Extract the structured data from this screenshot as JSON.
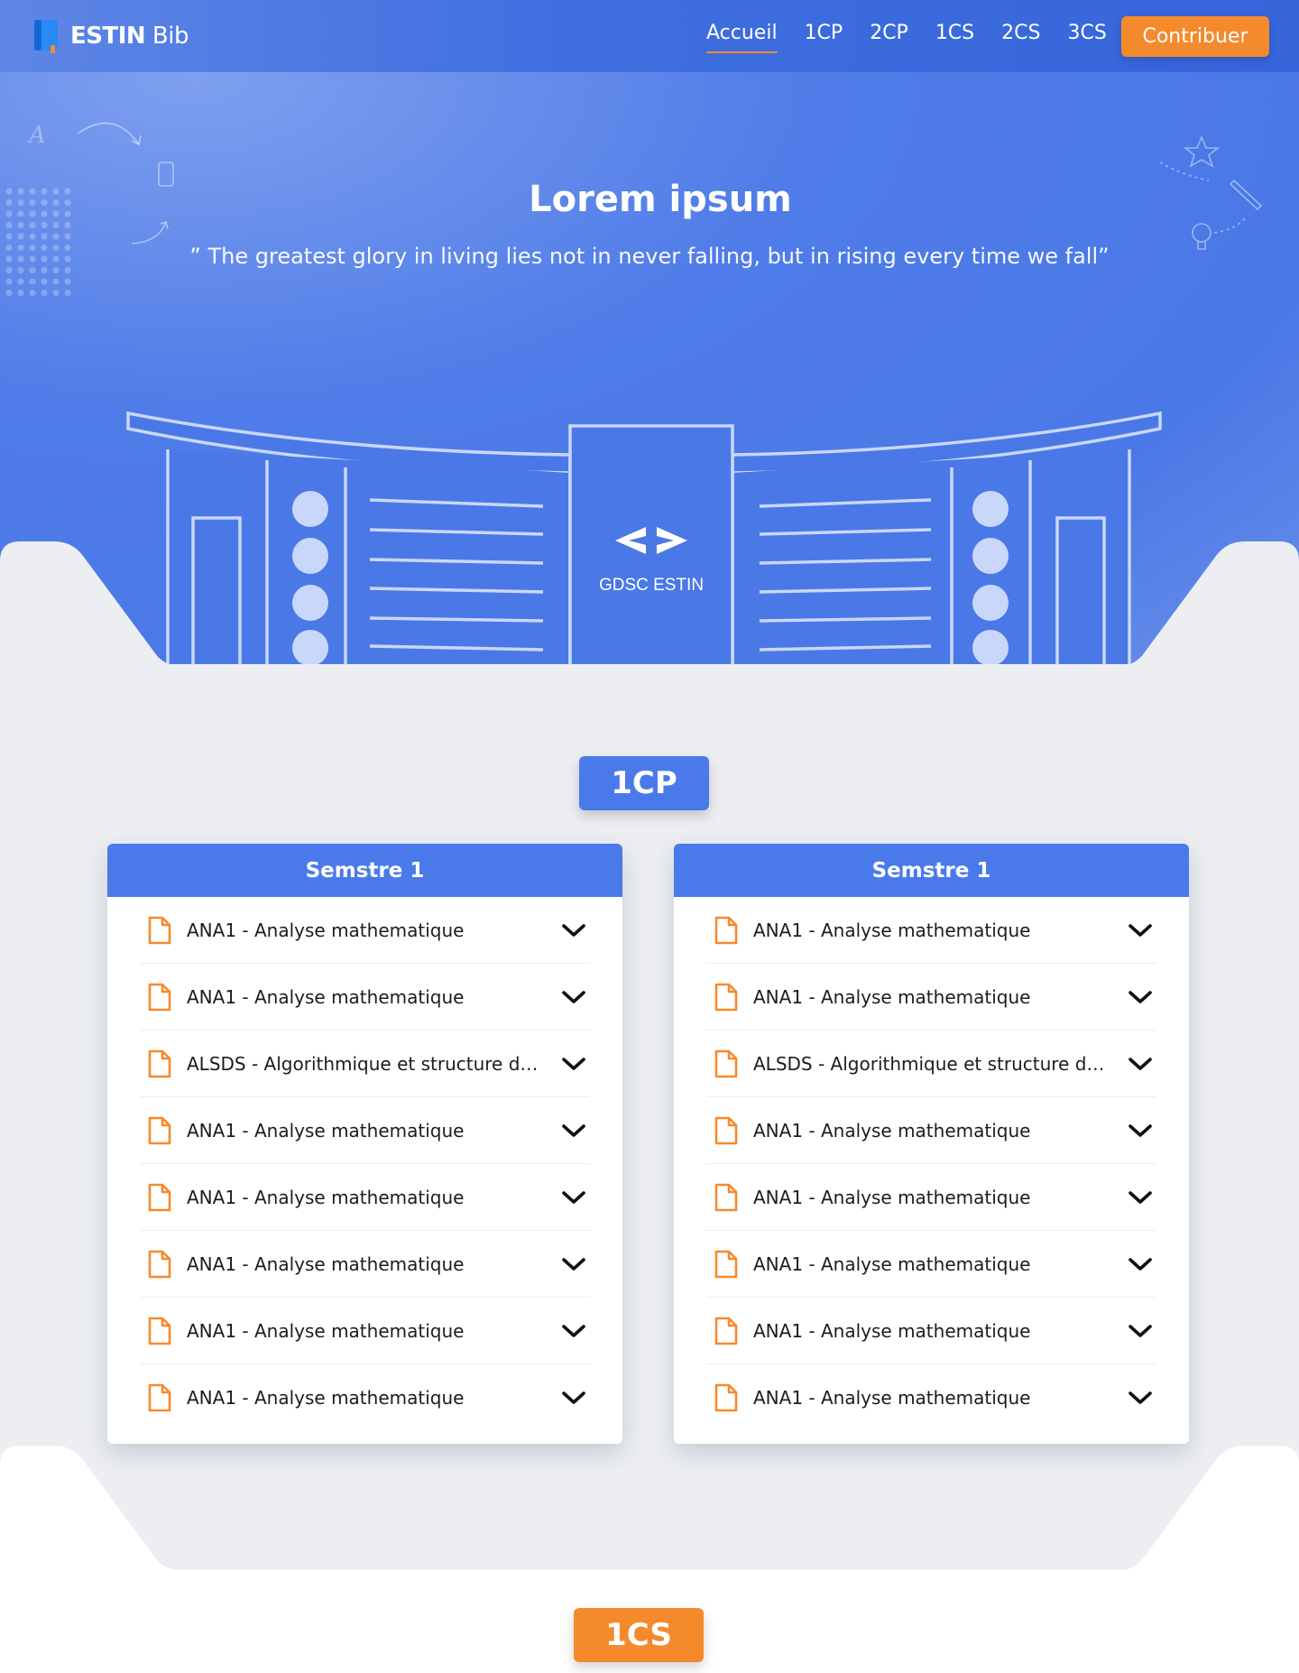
{
  "nav": {
    "brand_bold": "ESTIN",
    "brand_rest": " Bib",
    "links": [
      "Accueil",
      "1CP",
      "2CP",
      "1CS",
      "2CS",
      "3CS"
    ],
    "active": "Accueil",
    "cta_label": "Contribuer"
  },
  "hero": {
    "title": "Lorem ipsum",
    "quote": "” The greatest glory in living lies not in never falling, but in rising every time we fall”",
    "building_sign": "GDSC ESTIN"
  },
  "sections": [
    {
      "badge": "1CP",
      "badge_color": "#4a7aea",
      "cards": [
        {
          "title": "Semstre 1",
          "items": [
            "ANA1 - Analyse mathematique",
            "ANA1 - Analyse mathematique",
            "ALSDS - Algorithmique et structure de...",
            "ANA1 - Analyse mathematique",
            "ANA1 - Analyse mathematique",
            "ANA1 - Analyse mathematique",
            "ANA1 - Analyse mathematique",
            "ANA1 - Analyse mathematique"
          ]
        },
        {
          "title": "Semstre 1",
          "items": [
            "ANA1 - Analyse mathematique",
            "ANA1 - Analyse mathematique",
            "ALSDS - Algorithmique et structure de...",
            "ANA1 - Analyse mathematique",
            "ANA1 - Analyse mathematique",
            "ANA1 - Analyse mathematique",
            "ANA1 - Analyse mathematique",
            "ANA1 - Analyse mathematique"
          ]
        }
      ]
    },
    {
      "badge": "1CS",
      "badge_color": "#f58a2c"
    }
  ],
  "colors": {
    "primary": "#4a7aea",
    "accent": "#f58a2c",
    "grey_bg": "#eceef2"
  },
  "icons": {
    "brand": "book-icon",
    "row": "document-icon",
    "expand": "chevron-down-icon"
  }
}
